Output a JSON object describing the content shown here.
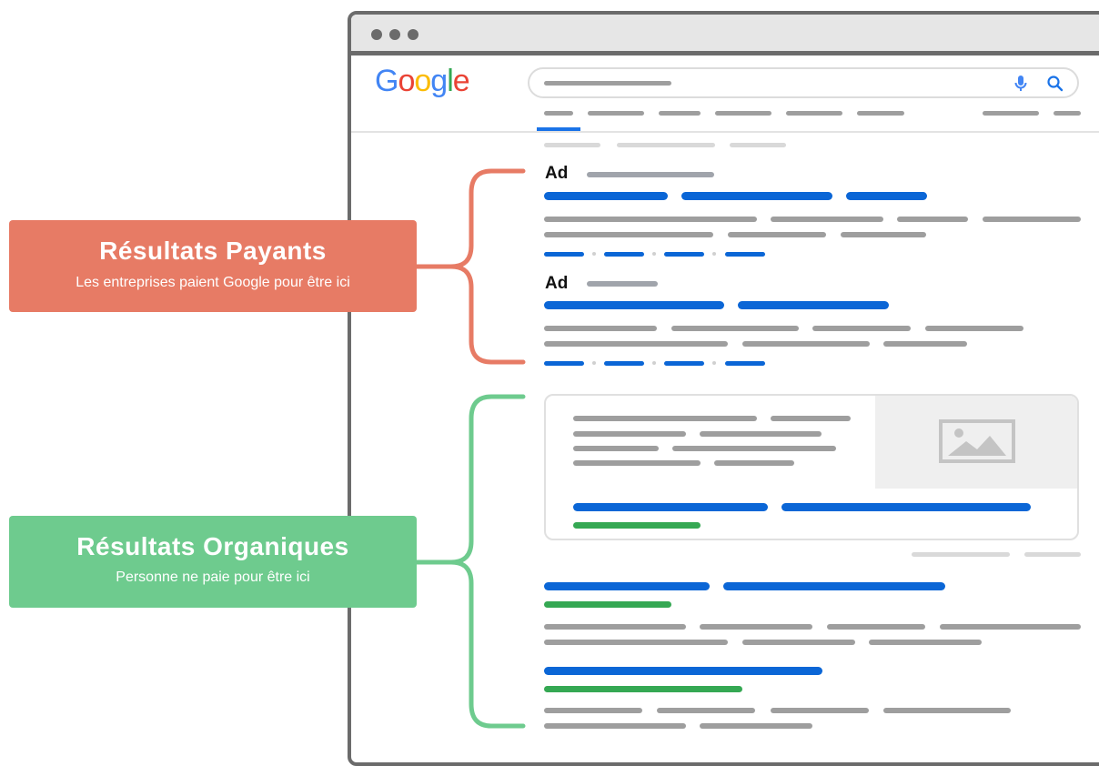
{
  "search_engine": {
    "logo_letters": [
      {
        "char": "G",
        "color": "#4285F4"
      },
      {
        "char": "o",
        "color": "#EA4335"
      },
      {
        "char": "o",
        "color": "#FBBC05"
      },
      {
        "char": "g",
        "color": "#4285F4"
      },
      {
        "char": "l",
        "color": "#34A853"
      },
      {
        "char": "e",
        "color": "#EA4335"
      }
    ],
    "search_icons": [
      "microphone-icon",
      "search-icon"
    ]
  },
  "results": {
    "ads": [
      {
        "label": "Ad"
      },
      {
        "label": "Ad"
      }
    ]
  },
  "callouts": {
    "paid": {
      "title": "Résultats Payants",
      "subtitle": "Les entreprises paient Google pour être ici",
      "color": "#e77b65"
    },
    "organic": {
      "title": "Résultats Organiques",
      "subtitle": "Personne ne paie pour être ici",
      "color": "#6ecb8e"
    }
  },
  "colors": {
    "link_blue": "#0b66d6",
    "url_green": "#35a853",
    "text_gray": "#9e9e9e",
    "frame": "#6b6b6b"
  }
}
